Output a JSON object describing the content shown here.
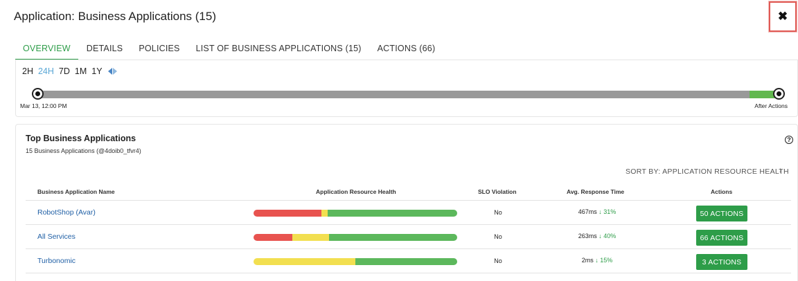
{
  "header": {
    "title": "Application: Business Applications (15)",
    "close_icon": "close-icon"
  },
  "tabs": [
    {
      "label": "OVERVIEW",
      "active": true
    },
    {
      "label": "DETAILS"
    },
    {
      "label": "POLICIES"
    },
    {
      "label": "LIST OF BUSINESS APPLICATIONS (15)"
    },
    {
      "label": "ACTIONS (66)"
    }
  ],
  "timeline": {
    "ranges": [
      "2H",
      "24H",
      "7D",
      "1M",
      "1Y"
    ],
    "selected": "24H",
    "start_label": "Mar 13, 12:00 PM",
    "end_label": "After Actions"
  },
  "card": {
    "title": "Top Business Applications",
    "subtitle": "15 Business Applications (@4doib0_tfvr4)",
    "help_icon": "?",
    "sort_label": "SORT BY: APPLICATION RESOURCE HEALTH",
    "sort_icon": "↓",
    "columns": {
      "name": "Business Application Name",
      "health": "Application Resource Health",
      "slo": "SLO Violation",
      "response": "Avg. Response Time",
      "actions": "Actions"
    },
    "rows": [
      {
        "name": "RobotShop (Avar)",
        "health": {
          "red": 0.335,
          "yellow": 0.03,
          "green": 0.635
        },
        "slo": "No",
        "response": "467ms",
        "change": "31%",
        "actions_label": "50 ACTIONS"
      },
      {
        "name": "All Services",
        "health": {
          "red": 0.19,
          "yellow": 0.18,
          "green": 0.63
        },
        "slo": "No",
        "response": "263ms",
        "change": "40%",
        "actions_label": "66 ACTIONS"
      },
      {
        "name": "Turbonomic",
        "health": {
          "red": 0,
          "yellow": 0.5,
          "green": 0.5
        },
        "slo": "No",
        "response": "2ms",
        "change": "15%",
        "actions_label": "3 ACTIONS"
      }
    ]
  },
  "colors": {
    "accent": "#2e9d49",
    "link": "#1f5fa5",
    "red": "#e8534f",
    "yellow": "#f2df50",
    "green": "#5cb85c"
  }
}
